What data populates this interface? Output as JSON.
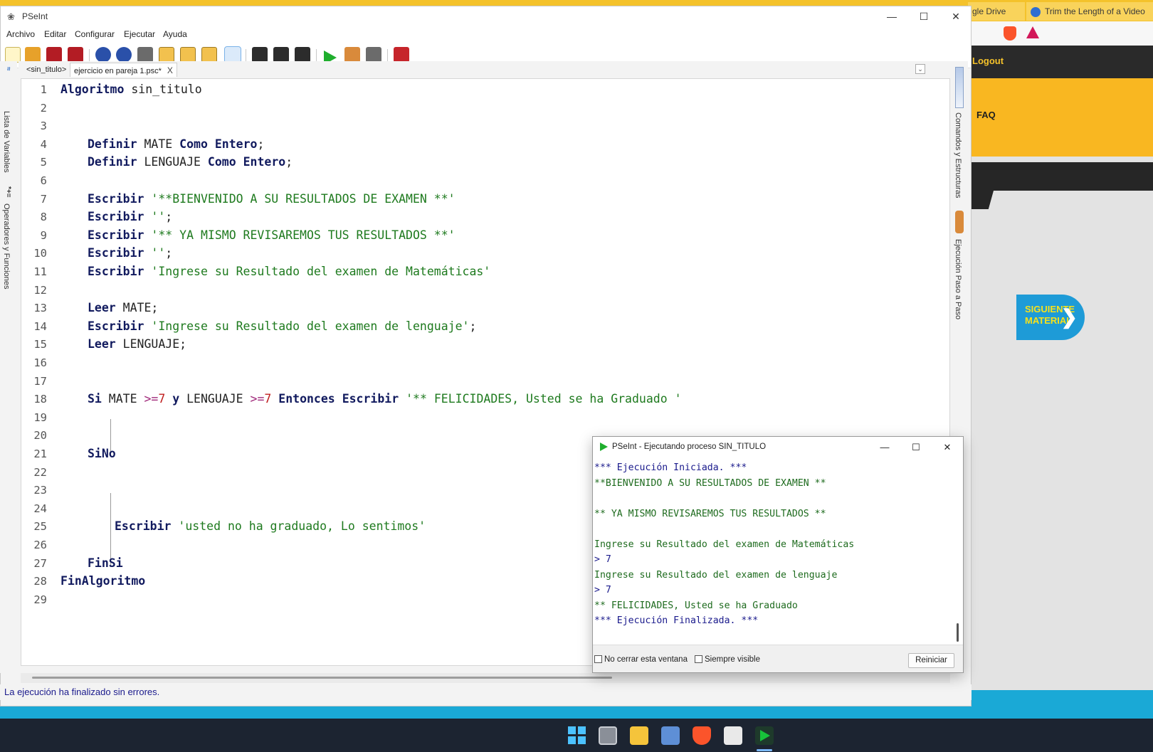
{
  "browser": {
    "tabs": [
      "gle Drive",
      "Trim the Length of a Video"
    ],
    "nav": {
      "logout": "Logout",
      "faq": "FAQ"
    },
    "next_material": {
      "line1": "SIGUIENTE",
      "line2": "MATERIAL"
    }
  },
  "window": {
    "title": "PSeInt",
    "controls": {
      "minimize": "—",
      "maximize": "☐",
      "close": "✕"
    }
  },
  "menu": [
    "Archivo",
    "Editar",
    "Configurar",
    "Ejecutar",
    "Ayuda"
  ],
  "toolbar_icons": [
    "new-icon",
    "open-icon",
    "save-icon",
    "save-as-icon",
    "undo-icon",
    "redo-icon",
    "cut-icon",
    "copy-icon",
    "paste-icon",
    "indent-icon",
    "inspect-icon",
    "search-icon",
    "find-next-icon",
    "replace-icon",
    "run-icon",
    "step-icon",
    "flowchart-icon",
    "help-icon"
  ],
  "tabs": [
    {
      "label": "<sin_titulo>"
    },
    {
      "label": "ejercicio en pareja 1.psc*",
      "close": "X"
    }
  ],
  "side_panels": {
    "left": [
      "Lista de Variables",
      "Operadores y Funciones"
    ],
    "right": [
      "Comandos y Estructuras",
      "Ejecución Paso a Paso"
    ]
  },
  "code_lines": [
    "Algoritmo sin_titulo",
    "",
    "",
    "Definir MATE Como Entero;",
    "Definir LENGUAJE Como Entero;",
    "",
    "Escribir '**BIENVENIDO A SU RESULTADOS DE EXAMEN **'",
    "Escribir '';",
    "Escribir '** YA MISMO REVISAREMOS TUS RESULTADOS **'",
    "Escribir '';",
    "Escribir 'Ingrese su Resultado del examen de Matemáticas'",
    "",
    "Leer MATE;",
    "Escribir 'Ingrese su Resultado del examen de lenguaje';",
    "Leer LENGUAJE;",
    "",
    "",
    "Si MATE >=7 y LENGUAJE >=7 Entonces Escribir '** FELICIDADES, Usted se ha Graduado '",
    "",
    "",
    "SiNo",
    "",
    "",
    "",
    "Escribir 'usted no ha graduado, Lo sentimos'",
    "",
    "FinSi",
    "FinAlgoritmo",
    ""
  ],
  "status": "La ejecución ha finalizado sin errores.",
  "execution_window": {
    "title": "PSeInt - Ejecutando proceso SIN_TITULO",
    "console": [
      {
        "type": "info",
        "text": "*** Ejecución Iniciada. ***"
      },
      {
        "type": "out",
        "text": "**BIENVENIDO A SU RESULTADOS DE EXAMEN **"
      },
      {
        "type": "out",
        "text": ""
      },
      {
        "type": "out",
        "text": "** YA MISMO REVISAREMOS TUS RESULTADOS **"
      },
      {
        "type": "out",
        "text": ""
      },
      {
        "type": "out",
        "text": "Ingrese su Resultado del examen de Matemáticas"
      },
      {
        "type": "in",
        "text": "> 7"
      },
      {
        "type": "out",
        "text": "Ingrese su Resultado del examen de lenguaje"
      },
      {
        "type": "in",
        "text": "> 7"
      },
      {
        "type": "out",
        "text": "** FELICIDADES, Usted se ha Graduado"
      },
      {
        "type": "info",
        "text": "*** Ejecución Finalizada. ***"
      }
    ],
    "options": {
      "no_close": "No cerrar esta ventana",
      "always_visible": "Siempre visible"
    },
    "restart_label": "Reiniciar"
  }
}
